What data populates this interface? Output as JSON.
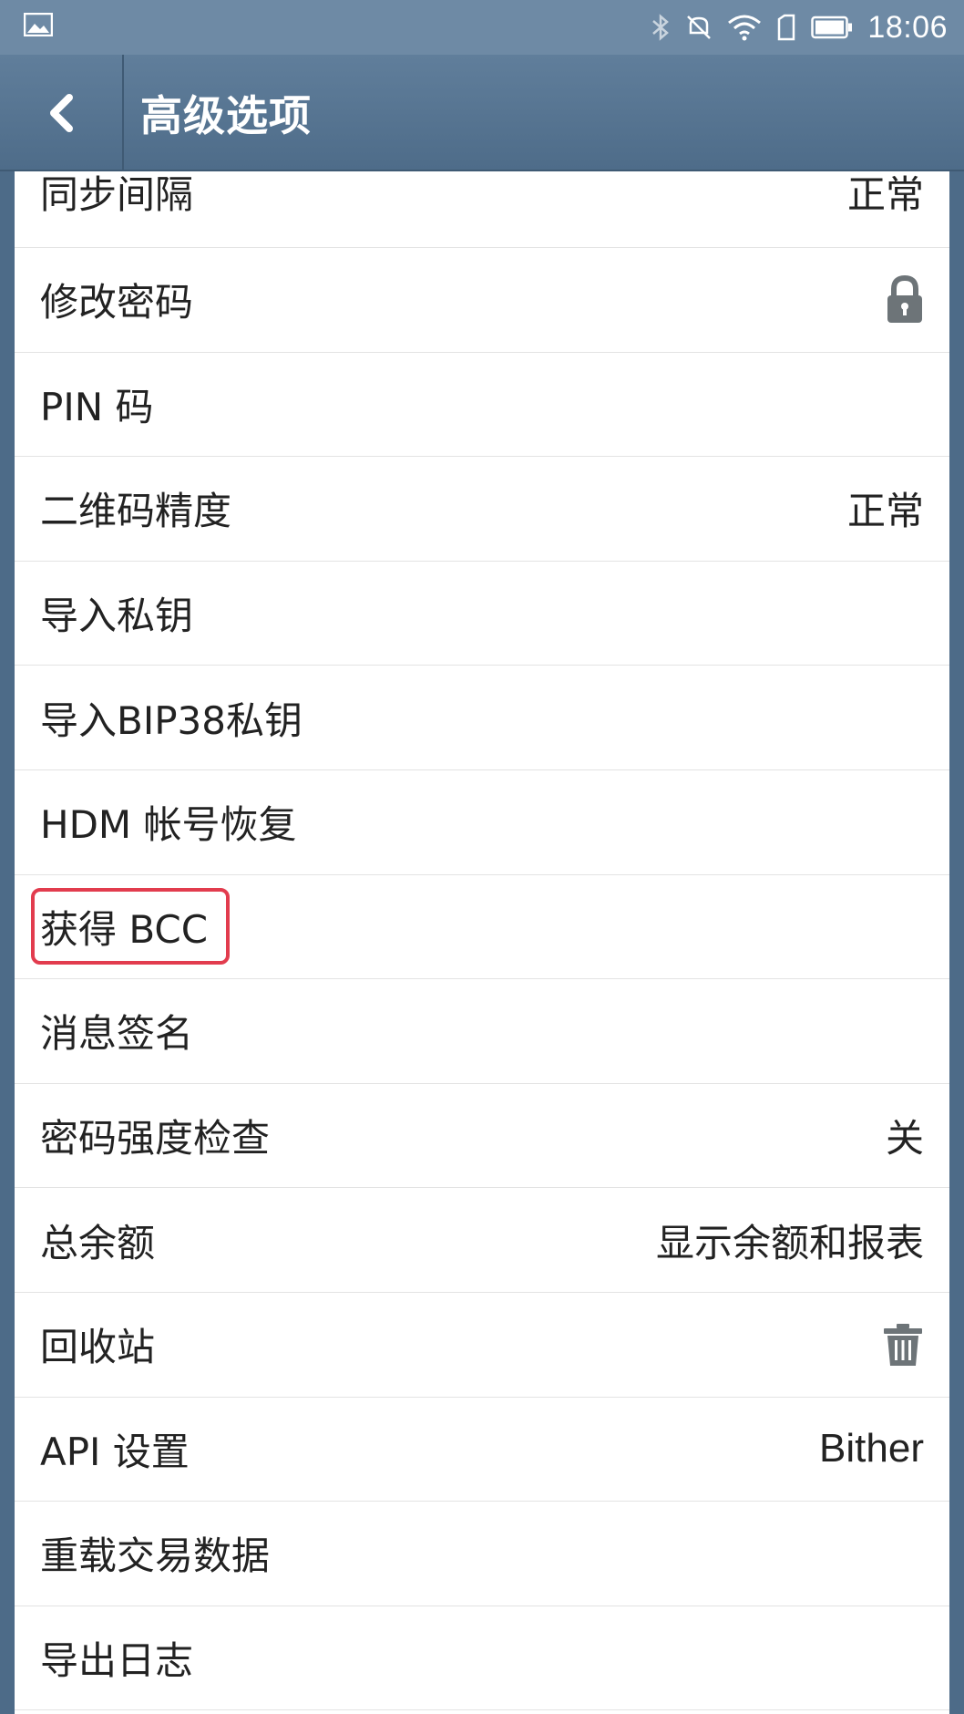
{
  "statusbar": {
    "time": "18:06",
    "left_icon": "image-notification-icon",
    "icons": [
      "bluetooth-icon",
      "mute-icon",
      "wifi-icon",
      "sim-icon",
      "battery-icon"
    ]
  },
  "header": {
    "title": "高级选项",
    "back_icon": "chevron-left-icon"
  },
  "settings": [
    {
      "label": "同步间隔",
      "value": "正常"
    },
    {
      "label": "修改密码",
      "icon": "lock-icon"
    },
    {
      "label": "PIN 码"
    },
    {
      "label": "二维码精度",
      "value": "正常"
    },
    {
      "label": "导入私钥"
    },
    {
      "label": "导入BIP38私钥"
    },
    {
      "label": "HDM 帐号恢复"
    },
    {
      "label": "获得 BCC",
      "highlighted": true
    },
    {
      "label": "消息签名"
    },
    {
      "label": "密码强度检查",
      "value": "关"
    },
    {
      "label": "总余额",
      "value": "显示余额和报表"
    },
    {
      "label": "回收站",
      "icon": "trash-icon"
    },
    {
      "label": "API 设置",
      "value": "Bither"
    },
    {
      "label": "重载交易数据"
    },
    {
      "label": "导出日志"
    }
  ],
  "colors": {
    "appbar": "#56728f",
    "highlight": "#e23c4e",
    "icon_gray": "#6d7478"
  }
}
